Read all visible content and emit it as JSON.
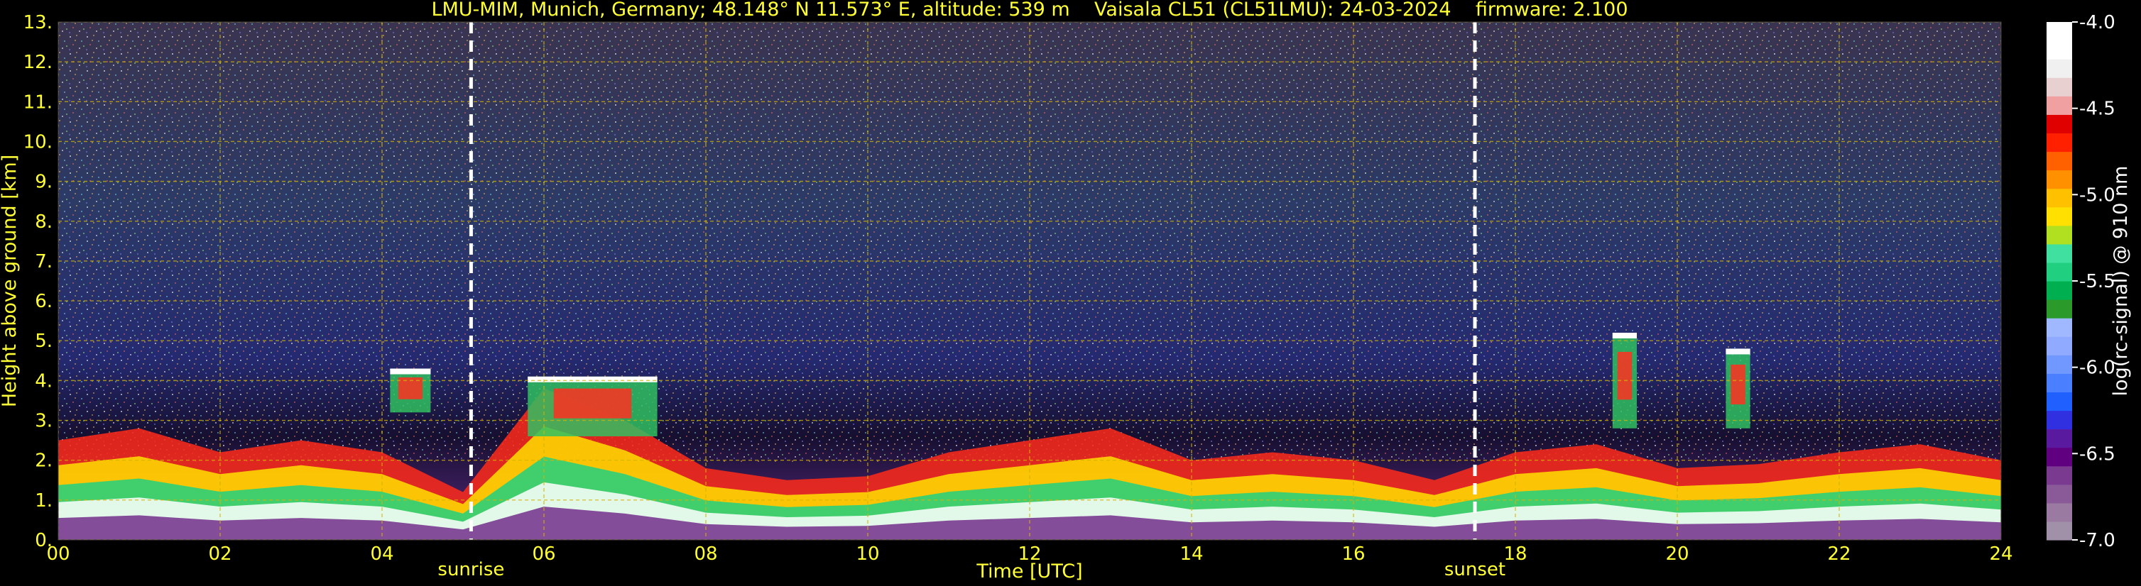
{
  "chart_data": {
    "type": "heatmap",
    "title": "LMU-MIM, Munich, Germany; 48.148° N 11.573° E, altitude: 539 m    Vaisala CL51 (CL51LMU): 24-03-2024    firmware: 2.100",
    "xlabel": "Time [UTC]",
    "ylabel": "Height above ground [km]",
    "xlim": [
      0,
      24
    ],
    "ylim": [
      0,
      13
    ],
    "x_ticks": [
      "00",
      "02",
      "04",
      "06",
      "08",
      "10",
      "12",
      "14",
      "16",
      "18",
      "20",
      "22",
      "24"
    ],
    "y_ticks": [
      "0.",
      "1.",
      "2.",
      "3.",
      "4.",
      "5.",
      "6.",
      "7.",
      "8.",
      "9.",
      "10.",
      "11.",
      "12.",
      "13."
    ],
    "grid": true,
    "events": [
      {
        "label": "sunrise",
        "time": 5.1
      },
      {
        "label": "sunset",
        "time": 17.5
      }
    ],
    "colorbar": {
      "label": "log(rc-signal) @ 910 nm",
      "range": [
        -7.0,
        -4.0
      ],
      "ticks": [
        "-7.0",
        "-6.5",
        "-6.0",
        "-5.5",
        "-5.0",
        "-4.5",
        "-4.0"
      ],
      "colors": [
        "#a090a8",
        "#9a7aa0",
        "#8a5a98",
        "#7a3a90",
        "#600080",
        "#5a1aa0",
        "#3030e0",
        "#2060ff",
        "#4a80ff",
        "#7098ff",
        "#90aaff",
        "#a0b8ff",
        "#2a9a2a",
        "#00b050",
        "#20d080",
        "#40e0a0",
        "#b0e020",
        "#ffe000",
        "#ffc000",
        "#ff9000",
        "#ff6000",
        "#ff2000",
        "#e00000",
        "#f0a0a0",
        "#e8d0d0",
        "#f0f0f0",
        "#ffffff",
        "#ffffff"
      ]
    },
    "features": {
      "boundary_layer_top_km": [
        [
          0,
          2.5
        ],
        [
          1,
          2.8
        ],
        [
          2,
          2.2
        ],
        [
          3,
          2.5
        ],
        [
          4,
          2.2
        ],
        [
          5,
          1.2
        ],
        [
          6,
          3.8
        ],
        [
          7,
          3.0
        ],
        [
          8,
          1.8
        ],
        [
          9,
          1.5
        ],
        [
          10,
          1.6
        ],
        [
          11,
          2.2
        ],
        [
          12,
          2.5
        ],
        [
          13,
          2.8
        ],
        [
          14,
          2.0
        ],
        [
          15,
          2.2
        ],
        [
          16,
          2.0
        ],
        [
          17,
          1.5
        ],
        [
          18,
          2.2
        ],
        [
          19,
          2.4
        ],
        [
          20,
          1.8
        ],
        [
          21,
          1.9
        ],
        [
          22,
          2.2
        ],
        [
          23,
          2.4
        ],
        [
          24,
          2.0
        ]
      ],
      "clouds": [
        {
          "time_start": 4.1,
          "time_end": 4.6,
          "height_base_km": 3.2,
          "height_top_km": 4.3
        },
        {
          "time_start": 5.8,
          "time_end": 7.4,
          "height_base_km": 2.6,
          "height_top_km": 4.1
        },
        {
          "time_start": 19.2,
          "time_end": 19.5,
          "height_base_km": 2.8,
          "height_top_km": 5.2
        },
        {
          "time_start": 20.6,
          "time_end": 20.9,
          "height_base_km": 2.8,
          "height_top_km": 4.8
        }
      ]
    }
  }
}
